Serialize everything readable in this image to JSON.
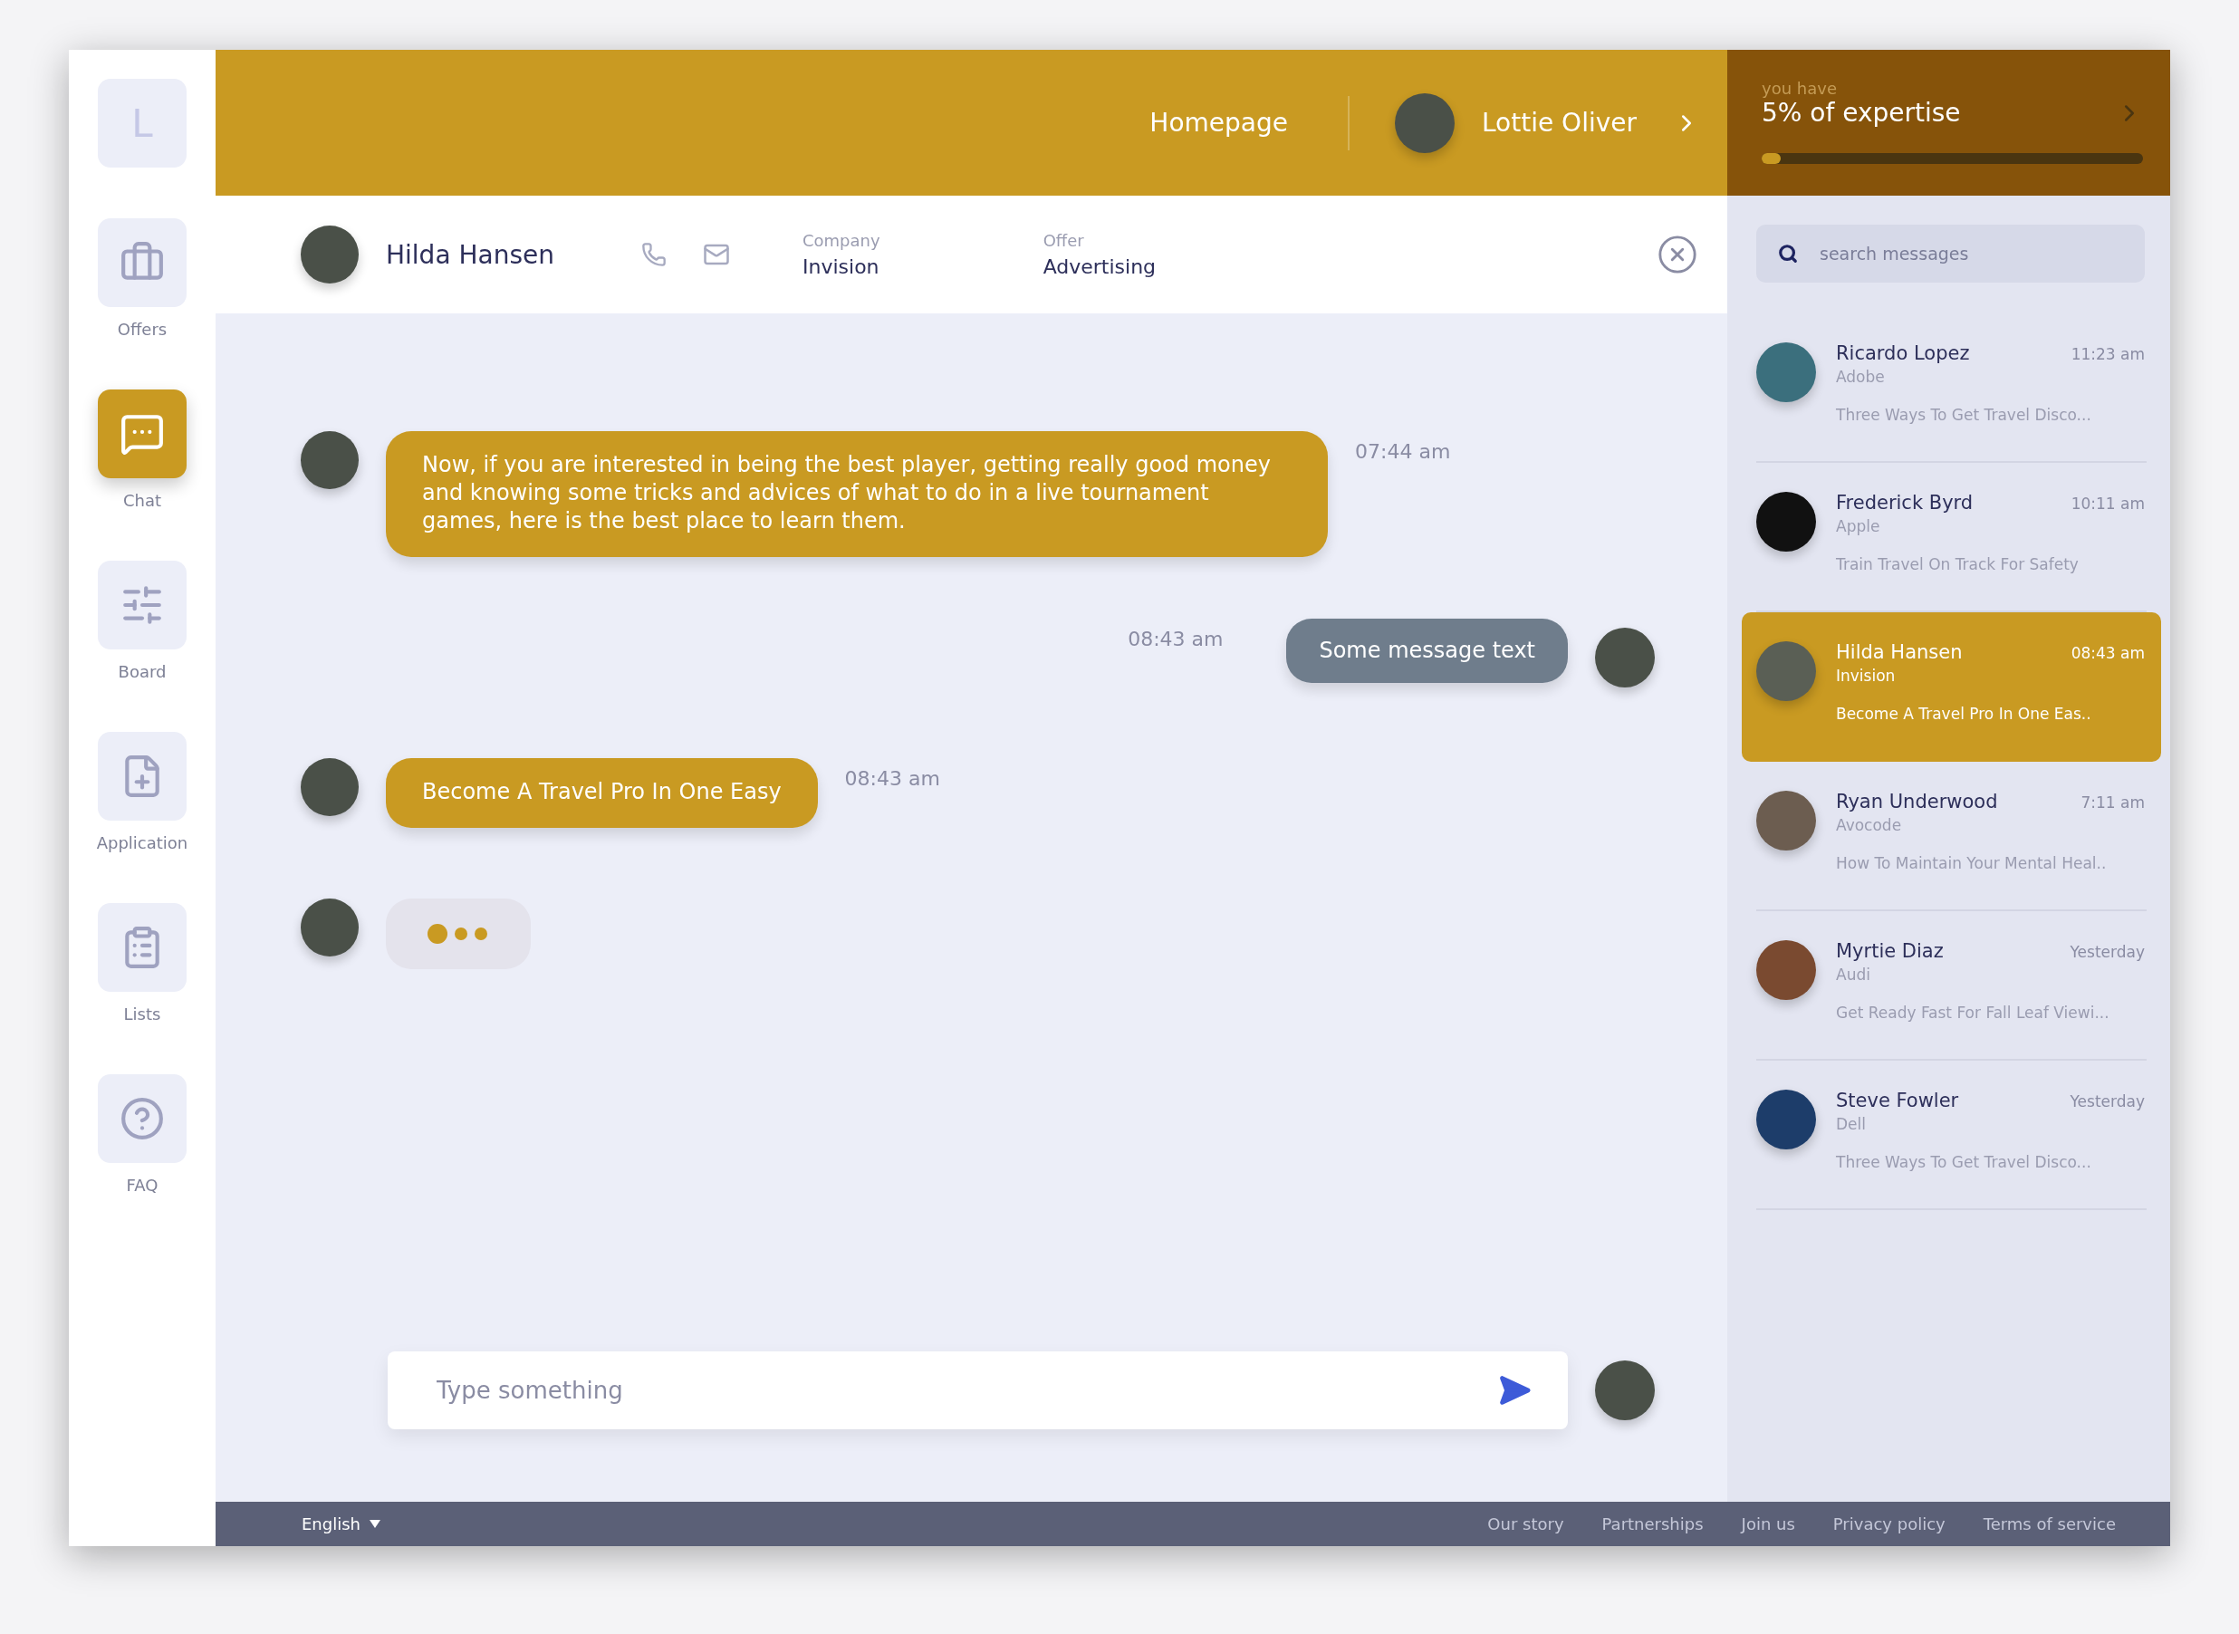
{
  "sidebar": {
    "logo": "L",
    "items": [
      {
        "label": "Offers",
        "selected": false
      },
      {
        "label": "Chat",
        "selected": true
      },
      {
        "label": "Board",
        "selected": false
      },
      {
        "label": "Application",
        "selected": false
      },
      {
        "label": "Lists",
        "selected": false
      },
      {
        "label": "FAQ",
        "selected": false
      }
    ]
  },
  "topbar": {
    "homepage": "Homepage",
    "user": "Lottie Oliver"
  },
  "expertise": {
    "caption": "you have",
    "title": "5% of expertise",
    "level": 0.05
  },
  "chat_header": {
    "name": "Hilda Hansen",
    "company_label": "Company",
    "company": "Invision",
    "offer_label": "Offer",
    "offer": "Advertising"
  },
  "messages": [
    {
      "kind": "incoming",
      "text": "Now, if you are interested in being the best player, getting really good money and knowing some tricks and advices of what to do in a live tournament games, here is the best place to learn them.",
      "time": "07:44 am"
    },
    {
      "kind": "outgoing",
      "text": "Some message text",
      "time": "08:43 am"
    },
    {
      "kind": "incoming",
      "text": "Become A Travel Pro In One Easy",
      "time": "08:43 am"
    },
    {
      "kind": "typing"
    }
  ],
  "composer": {
    "placeholder": "Type something"
  },
  "search": {
    "placeholder": "search messages"
  },
  "conversations": [
    {
      "name": "Ricardo Lopez",
      "company": "Adobe",
      "time": "11:23 am",
      "preview": "Three Ways To Get Travel Disco...",
      "selected": false
    },
    {
      "name": "Frederick Byrd",
      "company": "Apple",
      "time": "10:11 am",
      "preview": "Train Travel On Track For Safety",
      "selected": false
    },
    {
      "name": "Hilda Hansen",
      "company": "Invision",
      "time": "08:43 am",
      "preview": "Become A Travel Pro In One Eas..",
      "selected": true
    },
    {
      "name": "Ryan Underwood",
      "company": "Avocode",
      "time": "7:11 am",
      "preview": "How To Maintain Your Mental Heal..",
      "selected": false
    },
    {
      "name": "Myrtie Diaz",
      "company": "Audi",
      "time": "Yesterday",
      "preview": "Get Ready Fast For Fall Leaf Viewi...",
      "selected": false
    },
    {
      "name": "Steve Fowler",
      "company": "Dell",
      "time": "Yesterday",
      "preview": "Three Ways To Get Travel Disco...",
      "selected": false
    }
  ],
  "footer": {
    "language": "English",
    "links": [
      "Our story",
      "Partnerships",
      "Join us",
      "Privacy policy",
      "Terms of service"
    ]
  }
}
